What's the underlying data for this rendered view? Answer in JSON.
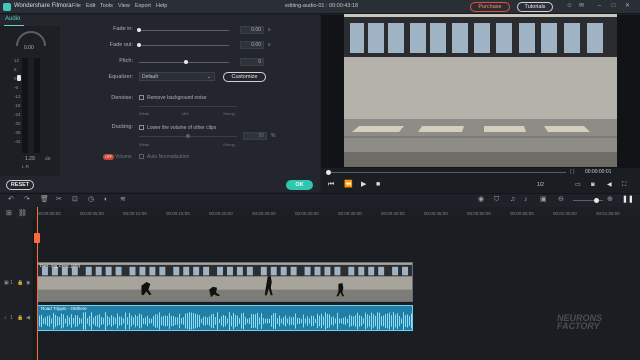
{
  "titlebar": {
    "app_name": "Wondershare Filmora",
    "menu": [
      "File",
      "Edit",
      "Tools",
      "View",
      "Export",
      "Help"
    ],
    "document": "editing-audio-01 : 00:00:43:18",
    "purchase_label": "Purchase",
    "tutorials_label": "Tutorials"
  },
  "left_panel": {
    "tab": "Audio",
    "meter": {
      "top_value": "0.00",
      "bottom_value": "1.29",
      "bottom_unit": "dB",
      "scale": [
        "12",
        "6",
        "0",
        "-6",
        "-12",
        "-18",
        "-24",
        "-30",
        "-36",
        "-42"
      ],
      "lr": "L  R"
    },
    "fade_in": {
      "label": "Fade in:",
      "value": "0.00",
      "unit": "s"
    },
    "fade_out": {
      "label": "Fade out:",
      "value": "0.00",
      "unit": "s"
    },
    "pitch": {
      "label": "Pitch:",
      "value": "0"
    },
    "equalizer": {
      "label": "Equalizer:",
      "selected": "Default",
      "customize_label": "Customize"
    },
    "denoise": {
      "label": "Denoise:",
      "checkbox_label": "Remove background noise",
      "scale": [
        "Weak",
        "Mid",
        "Strong"
      ]
    },
    "ducking": {
      "label": "Ducking:",
      "checkbox_label": "Lower the volume of other clips",
      "value": "50",
      "unit": "%",
      "scale": [
        "Weak",
        "Strong"
      ]
    },
    "volume_toggle": "OFF",
    "volume_label": "Volume",
    "auto_normalization": "Auto Normalization",
    "reset_label": "RESET",
    "ok_label": "OK"
  },
  "preview": {
    "timecode": "00:00:00:01",
    "ratio": "1/2",
    "braces": "{      }"
  },
  "timeline": {
    "ruler": [
      "00:00:00:00",
      "00:00:05:00",
      "00:00:10:00",
      "00:00:15:00",
      "00:00:20:00",
      "00:00:25:00",
      "00:00:30:00",
      "00:00:35:00",
      "00:00:40:00",
      "00:00:45:00",
      "00:00:50:00",
      "00:00:55:00",
      "00:01:00:00",
      "00:01:05:00"
    ],
    "video_clip_label": "Dani...ing_Crew_(480)",
    "audio_clip_label": "Road Trippin - OMhere",
    "track_heads": [
      "1",
      "1"
    ]
  },
  "watermark": "NEURONS FACTORY",
  "colors": {
    "accent": "#2fc7b0",
    "playhead": "#ff6a3d",
    "audio_clip": "#1f7fa6"
  }
}
